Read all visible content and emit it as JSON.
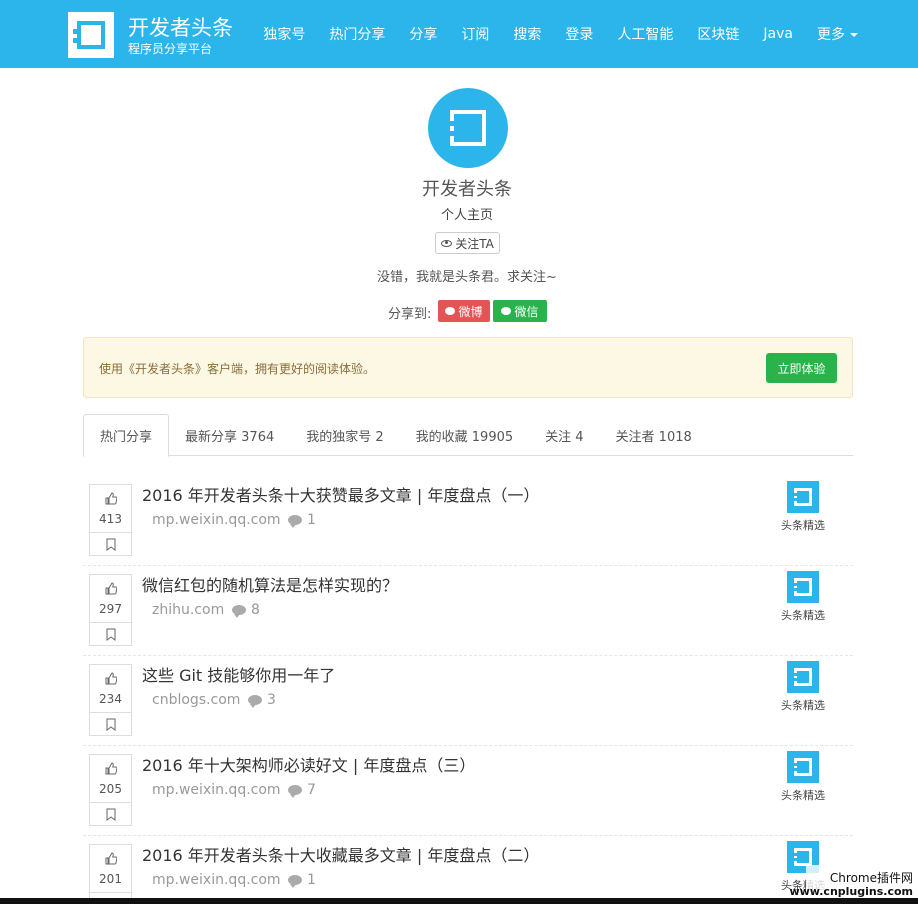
{
  "header": {
    "brand_title": "开发者头条",
    "brand_subtitle": "程序员分享平台",
    "bg_color": "#2bb5ea",
    "nav": [
      "独家号",
      "热门分享",
      "分享",
      "订阅",
      "搜索",
      "登录",
      "人工智能",
      "区块链",
      "Java"
    ],
    "more_label": "更多"
  },
  "profile": {
    "name": "开发者头条",
    "subtitle": "个人主页",
    "follow_label": "关注TA",
    "bio": "没错，我就是头条君。求关注~",
    "share_label": "分享到:",
    "weibo_label": "微博",
    "wechat_label": "微信"
  },
  "promo": {
    "text": "使用《开发者头条》客户端，拥有更好的阅读体验。",
    "button_label": "立即体验"
  },
  "tabs": [
    {
      "label": "热门分享"
    },
    {
      "label": "最新分享 3764"
    },
    {
      "label": "我的独家号 2"
    },
    {
      "label": "我的收藏 19905"
    },
    {
      "label": "关注 4"
    },
    {
      "label": "关注者 1018"
    }
  ],
  "articles": [
    {
      "title": "2016 年开发者头条十大获赞最多文章 | 年度盘点（一）",
      "domain": "mp.weixin.qq.com",
      "comments": "1",
      "votes": "413",
      "source": "头条精选"
    },
    {
      "title": "微信红包的随机算法是怎样实现的？",
      "domain": "zhihu.com",
      "comments": "8",
      "votes": "297",
      "source": "头条精选"
    },
    {
      "title": "这些 Git 技能够你用一年了",
      "domain": "cnblogs.com",
      "comments": "3",
      "votes": "234",
      "source": "头条精选"
    },
    {
      "title": "2016 年十大架构师必读好文 | 年度盘点（三）",
      "domain": "mp.weixin.qq.com",
      "comments": "7",
      "votes": "205",
      "source": "头条精选"
    },
    {
      "title": "2016 年开发者头条十大收藏最多文章 | 年度盘点（二）",
      "domain": "mp.weixin.qq.com",
      "comments": "1",
      "votes": "201",
      "source": "头条精选"
    }
  ],
  "watermark": {
    "line1": "Chrome插件网",
    "line2": "www.cnplugins.com"
  }
}
